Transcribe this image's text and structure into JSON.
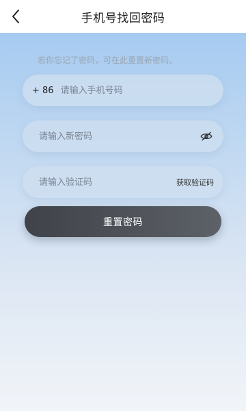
{
  "header": {
    "title": "手机号找回密码",
    "back_icon": "chevron-left-icon"
  },
  "form": {
    "hint": "若你忘记了密码，可在此重置新密码。",
    "phone": {
      "country_code": "+ 86",
      "placeholder": "请输入手机号码",
      "value": ""
    },
    "new_password": {
      "placeholder": "请输入新密码",
      "value": "",
      "toggle_icon": "eye-off-icon"
    },
    "verify_code": {
      "placeholder": "请输入验证码",
      "value": "",
      "get_code_label": "获取验证码"
    },
    "submit_label": "重置密码"
  },
  "colors": {
    "gradient_top": "#a6cbf1",
    "gradient_bottom": "#f1f4f8",
    "button_dark": "#3f4248"
  }
}
